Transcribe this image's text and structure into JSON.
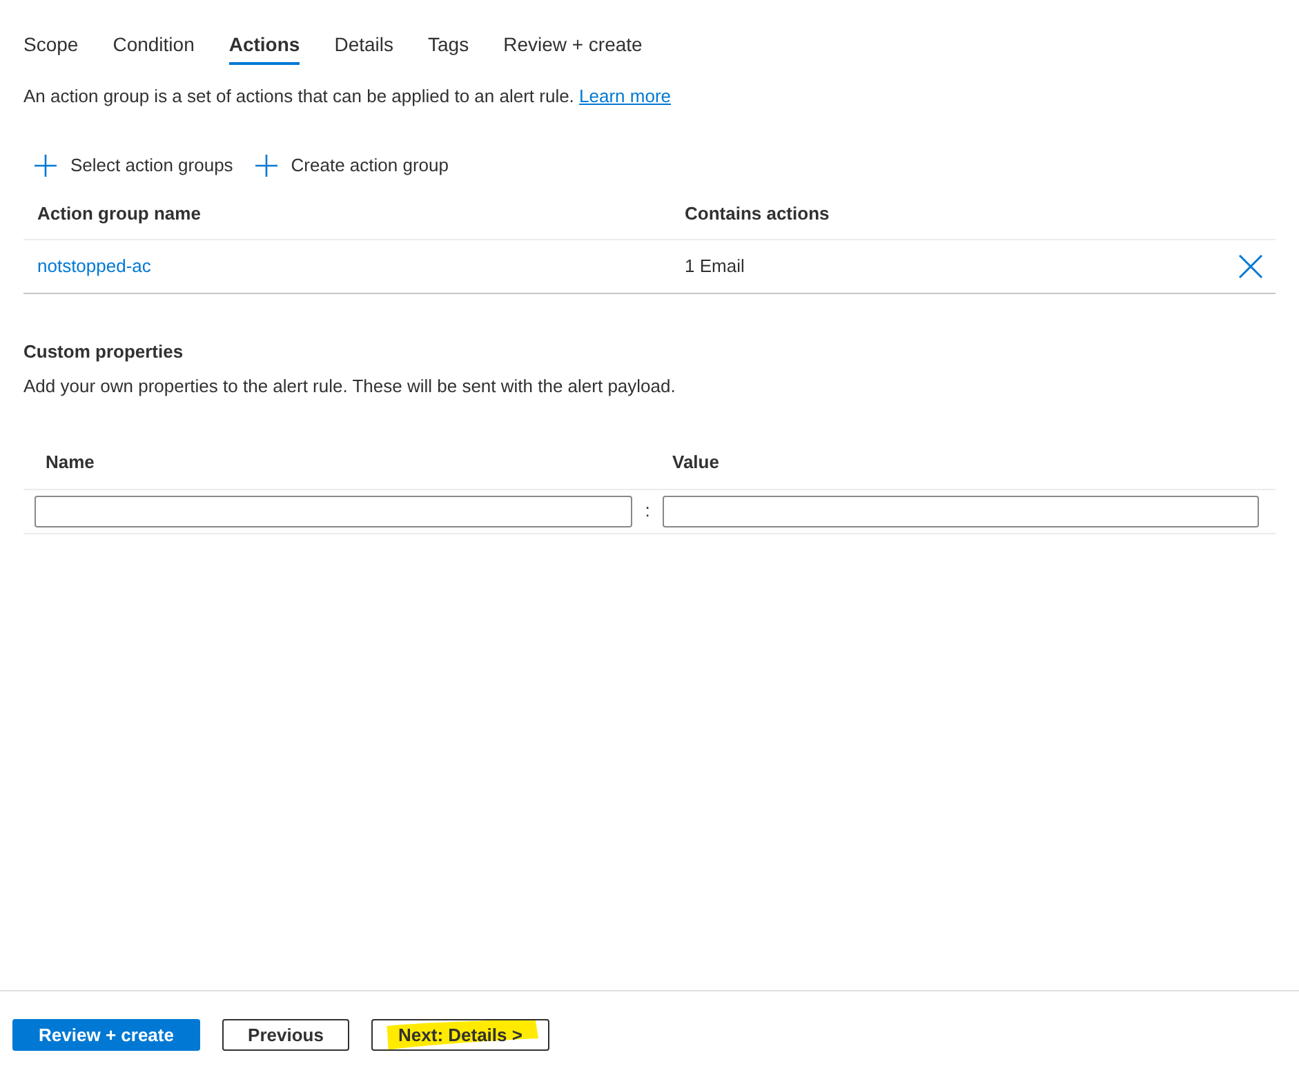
{
  "tabs": [
    {
      "label": "Scope",
      "selected": false
    },
    {
      "label": "Condition",
      "selected": false
    },
    {
      "label": "Actions",
      "selected": true
    },
    {
      "label": "Details",
      "selected": false
    },
    {
      "label": "Tags",
      "selected": false
    },
    {
      "label": "Review + create",
      "selected": false
    }
  ],
  "intro": {
    "text": "An action group is a set of actions that can be applied to an alert rule.",
    "link": "Learn more"
  },
  "toolbar": [
    "Select action groups",
    "Create action group"
  ],
  "action_groups": {
    "columns": [
      "Action group name",
      "Contains actions"
    ],
    "rows": [
      {
        "name": "notstopped-ac",
        "actions": "1 Email"
      }
    ]
  },
  "custom_properties": {
    "title": "Custom properties",
    "description": "Add your own properties to the alert rule. These will be sent with the alert payload.",
    "columns": [
      "Name",
      "Value"
    ],
    "separator": ":"
  },
  "footer_buttons": [
    {
      "label": "Review + create",
      "kind": "primary",
      "highlighted": false
    },
    {
      "label": "Previous",
      "kind": "secondary",
      "highlighted": false
    },
    {
      "label": "Next: Details >",
      "kind": "secondary",
      "highlighted": true
    }
  ]
}
